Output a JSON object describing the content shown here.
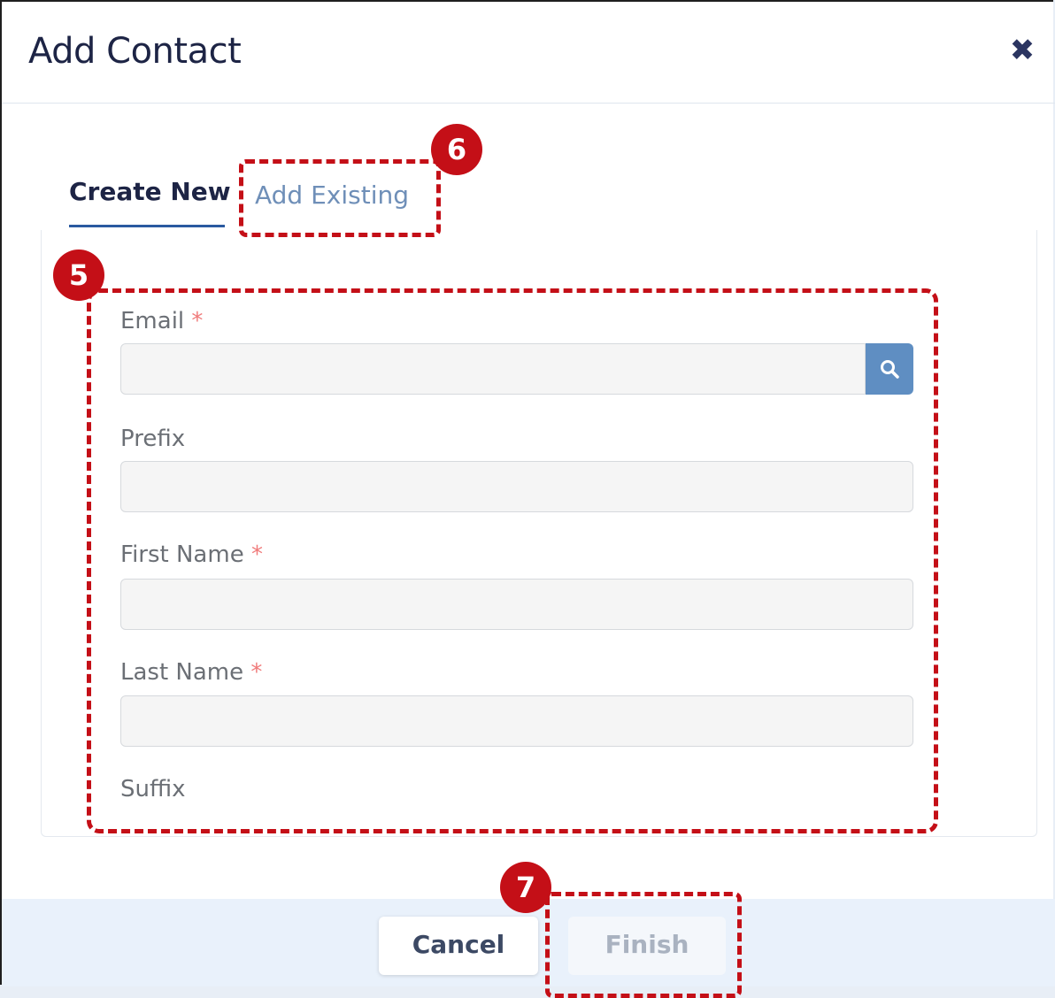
{
  "dialog": {
    "title": "Add Contact",
    "close_glyph": "✖"
  },
  "tabs": [
    {
      "label": "Create New",
      "active": true
    },
    {
      "label": "Add Existing",
      "active": false
    }
  ],
  "form": {
    "email": {
      "label": "Email",
      "required_mark": "*",
      "value": "",
      "search_icon": "search-icon"
    },
    "prefix": {
      "label": "Prefix",
      "value": ""
    },
    "first_name": {
      "label": "First Name",
      "required_mark": "*",
      "value": ""
    },
    "last_name": {
      "label": "Last Name",
      "required_mark": "*",
      "value": ""
    },
    "suffix": {
      "label": "Suffix"
    }
  },
  "footer": {
    "cancel_label": "Cancel",
    "finish_label": "Finish"
  },
  "callouts": {
    "form_badge": "5",
    "tab_badge": "6",
    "finish_badge": "7"
  },
  "colors": {
    "accent": "#2a5aa0",
    "callout": "#c40f17",
    "required": "#f07b7b"
  }
}
